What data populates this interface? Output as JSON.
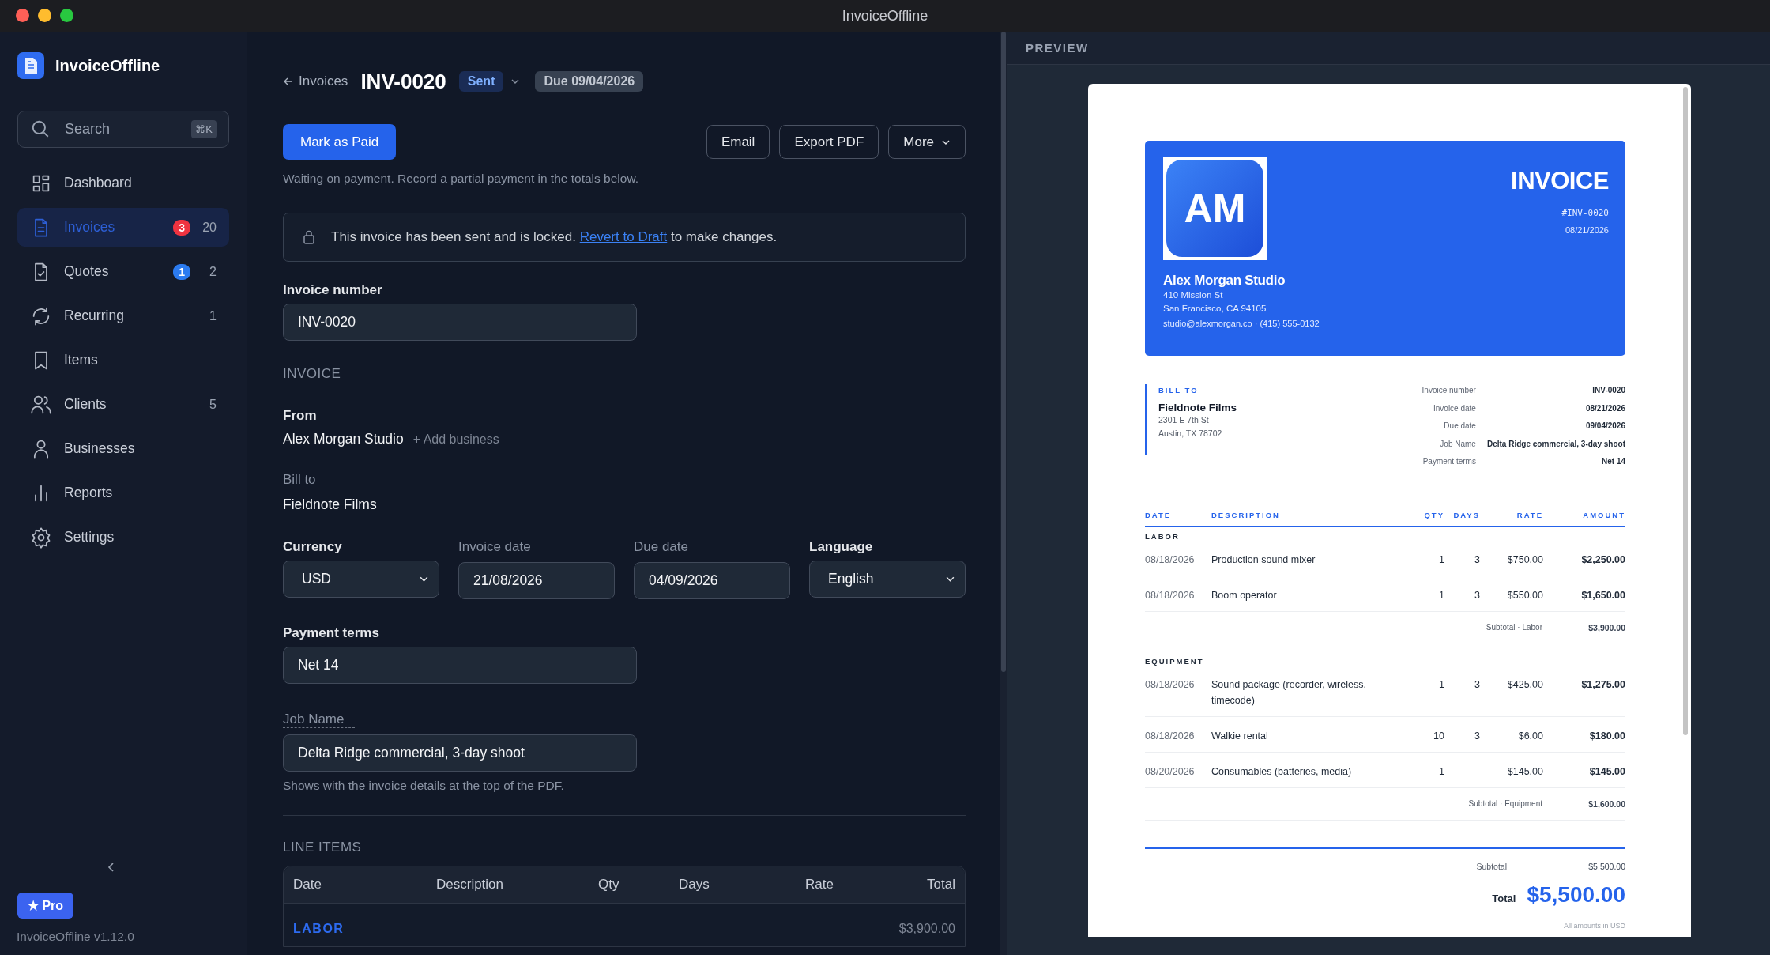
{
  "window": {
    "title": "InvoiceOffline"
  },
  "sidebar": {
    "app_name": "InvoiceOffline",
    "search": {
      "placeholder": "Search",
      "shortcut": "⌘K"
    },
    "items": [
      {
        "label": "Dashboard",
        "selected": false
      },
      {
        "label": "Invoices",
        "selected": true,
        "badge": {
          "label": "3",
          "color": "#ef3340"
        },
        "count": "20"
      },
      {
        "label": "Quotes",
        "selected": false,
        "badge": {
          "label": "1",
          "color": "#2b7bf0"
        },
        "count": "2"
      },
      {
        "label": "Recurring",
        "selected": false,
        "count": "1"
      },
      {
        "label": "Items",
        "selected": false
      },
      {
        "label": "Clients",
        "selected": false,
        "count": "5"
      },
      {
        "label": "Businesses",
        "selected": false
      },
      {
        "label": "Reports",
        "selected": false
      },
      {
        "label": "Settings",
        "selected": false
      }
    ],
    "pro": "★ Pro",
    "version": "InvoiceOffline v1.12.0"
  },
  "header": {
    "back": "Invoices",
    "title": "INV-0020",
    "status": "Sent",
    "due": "Due 09/04/2026"
  },
  "actions": {
    "primary": "Mark as Paid",
    "buttons": [
      {
        "label": "Email",
        "kind": "plain"
      },
      {
        "label": "Export PDF",
        "kind": "plain"
      },
      {
        "label": "More",
        "kind": "menu"
      }
    ]
  },
  "status_note": "Waiting on payment. Record a partial payment in the totals below.",
  "lock_notice": {
    "before": "This invoice has been sent and is locked.",
    "link": "Revert to Draft",
    "after": "to make changes."
  },
  "form": {
    "invoice_number": {
      "label": "Invoice number",
      "value": "INV-0020"
    },
    "section": "INVOICE",
    "from": {
      "label": "From",
      "value": "Alex Morgan Studio",
      "add": "+ Add business"
    },
    "bill_to": {
      "label": "Bill to",
      "value": "Fieldnote Films"
    },
    "row": [
      {
        "label": "Currency",
        "value": "USD",
        "kind": "select",
        "locked": false
      },
      {
        "label": "Invoice date",
        "value": "21/08/2026",
        "kind": "date",
        "locked": true
      },
      {
        "label": "Due date",
        "value": "04/09/2026",
        "kind": "date",
        "locked": true
      },
      {
        "label": "Language",
        "value": "English",
        "kind": "select",
        "locked": false
      }
    ],
    "payment_terms": {
      "label": "Payment terms",
      "value": "Net 14"
    },
    "job_name": {
      "label": "Job Name",
      "value": "Delta Ridge commercial, 3-day shoot",
      "help": "Shows with the invoice details at the top of the PDF.",
      "has_tooltip": true
    }
  },
  "line_items": {
    "title": "LINE ITEMS",
    "columns": [
      "Date",
      "Description",
      "Qty",
      "Days",
      "Rate",
      "Total"
    ],
    "groups": [
      {
        "name": "LABOR",
        "subtotal": "$3,900.00"
      }
    ]
  },
  "preview": {
    "label": "PREVIEW",
    "document": {
      "title": "INVOICE",
      "number": "#INV-0020",
      "date": "08/21/2026",
      "logo": "AM",
      "business": "Alex Morgan Studio",
      "address": [
        "410 Mission St",
        "San Francisco, CA 94105"
      ],
      "contact": "studio@alexmorgan.co · (415) 555-0132",
      "bill_to_label": "BILL TO",
      "client": "Fieldnote Films",
      "client_address": [
        "2301 E 7th St",
        "Austin, TX 78702"
      ],
      "meta": [
        {
          "label": "Invoice number",
          "value": "INV-0020"
        },
        {
          "label": "Invoice date",
          "value": "08/21/2026"
        },
        {
          "label": "Due date",
          "value": "09/04/2026"
        },
        {
          "label": "Job Name",
          "value": "Delta Ridge commercial, 3-day shoot"
        },
        {
          "label": "Payment terms",
          "value": "Net 14"
        }
      ],
      "columns": [
        "DATE",
        "DESCRIPTION",
        "QTY",
        "DAYS",
        "RATE",
        "AMOUNT"
      ],
      "groups": [
        {
          "name": "LABOR",
          "rows": [
            {
              "date": "08/18/2026",
              "description": "Production sound mixer",
              "qty": "1",
              "days": "3",
              "rate": "$750.00",
              "amount": "$2,250.00"
            },
            {
              "date": "08/18/2026",
              "description": "Boom operator",
              "qty": "1",
              "days": "3",
              "rate": "$550.00",
              "amount": "$1,650.00"
            }
          ],
          "subtotal_label": "Subtotal · Labor",
          "subtotal": "$3,900.00"
        },
        {
          "name": "EQUIPMENT",
          "rows": [
            {
              "date": "08/18/2026",
              "description": "Sound package (recorder, wireless, timecode)",
              "qty": "1",
              "days": "3",
              "rate": "$425.00",
              "amount": "$1,275.00"
            },
            {
              "date": "08/18/2026",
              "description": "Walkie rental",
              "qty": "10",
              "days": "3",
              "rate": "$6.00",
              "amount": "$180.00"
            },
            {
              "date": "08/20/2026",
              "description": "Consumables (batteries, media)",
              "qty": "1",
              "rate": "$145.00",
              "amount": "$145.00"
            }
          ],
          "subtotal_label": "Subtotal · Equipment",
          "subtotal": "$1,600.00"
        }
      ],
      "subtotal_label": "Subtotal",
      "subtotal": "$5,500.00",
      "total_label": "Total",
      "total": "$5,500.00",
      "footnote": "All amounts in USD"
    }
  }
}
